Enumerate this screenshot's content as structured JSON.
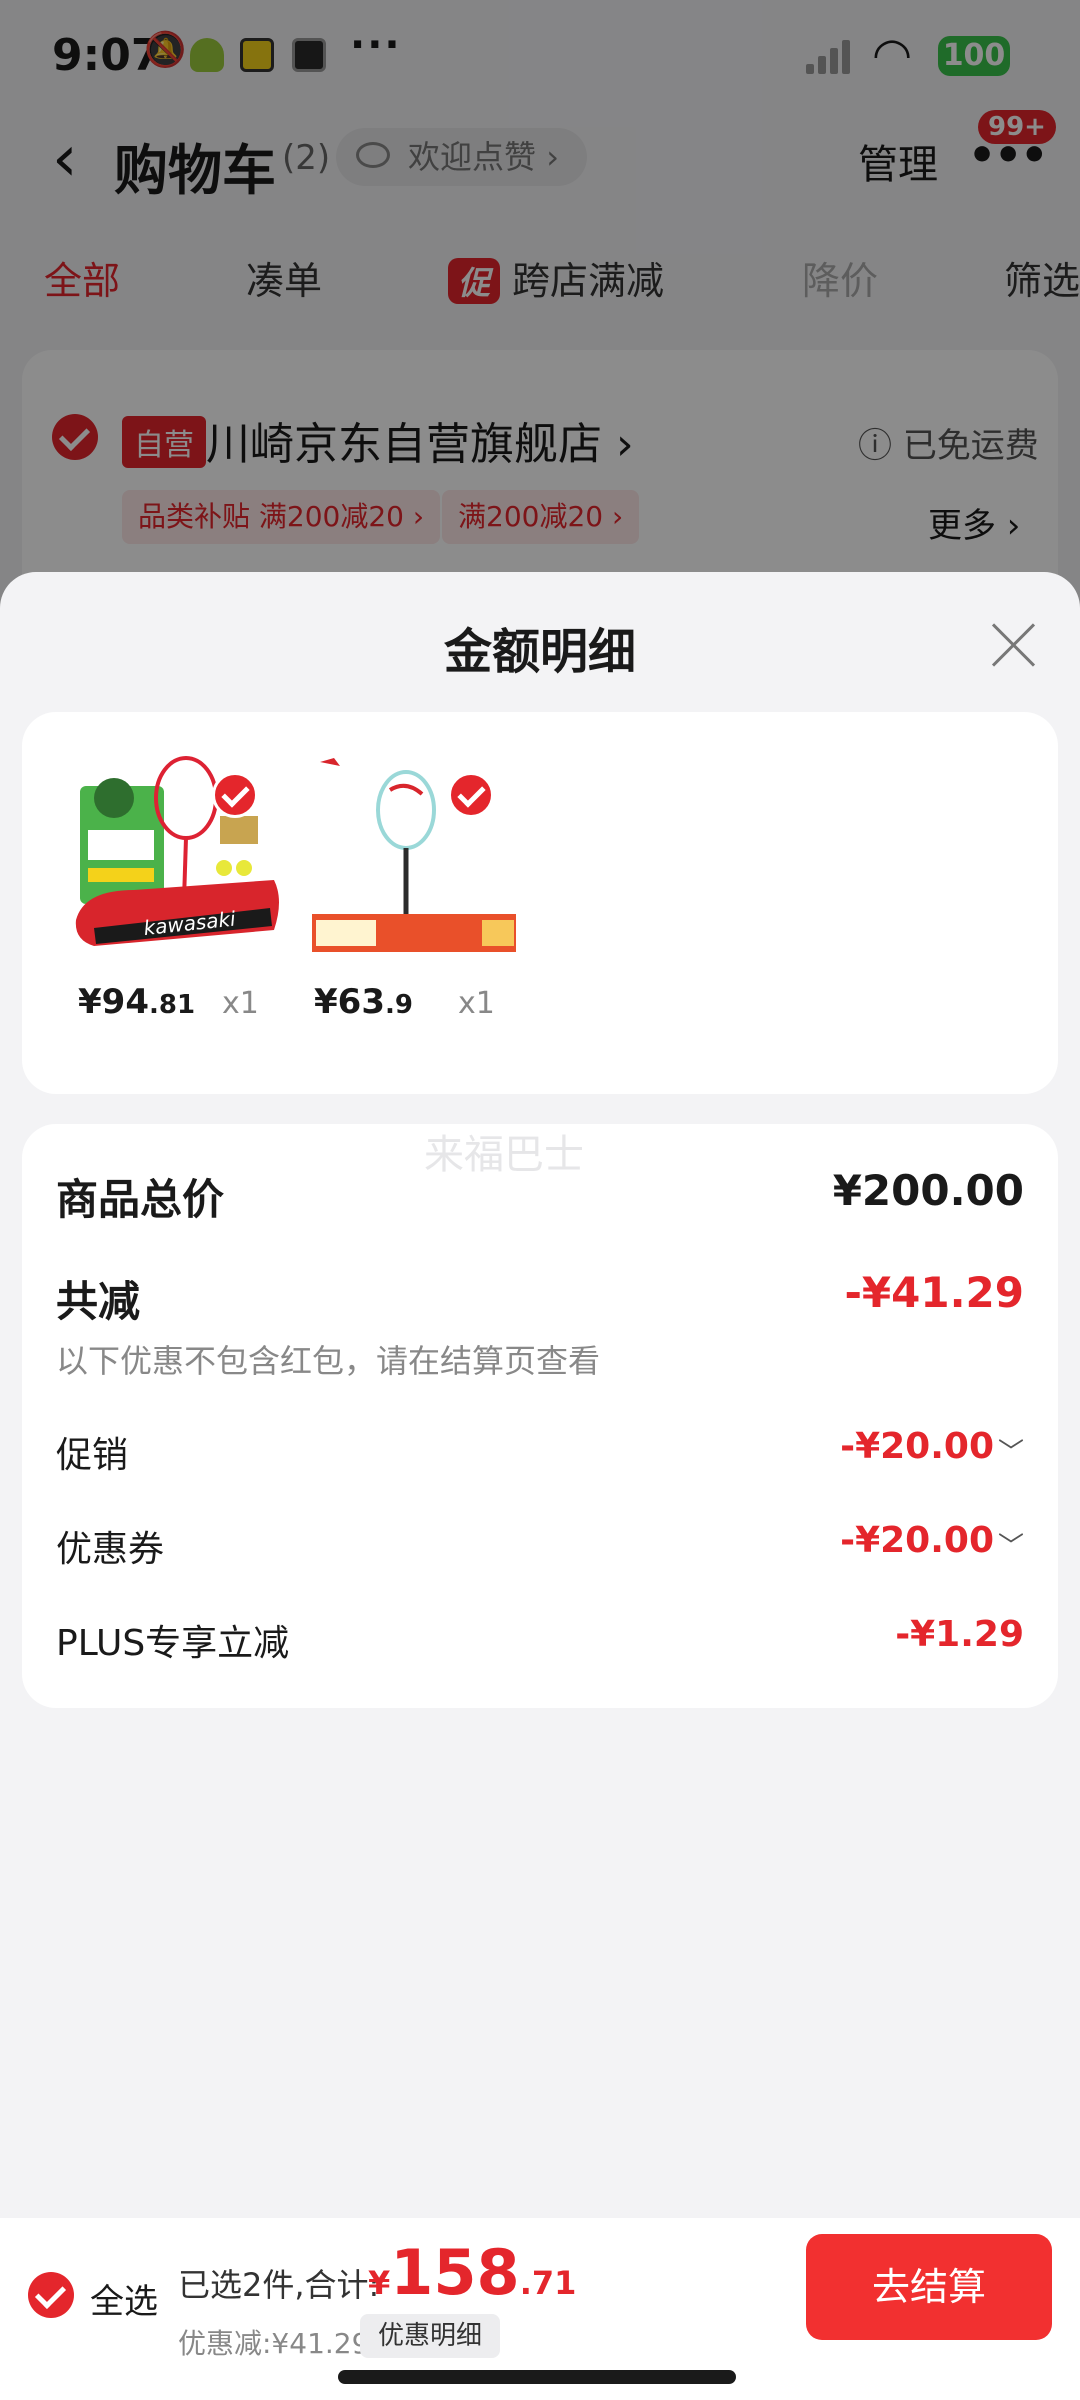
{
  "status_bar": {
    "time": "9:07",
    "battery": "100"
  },
  "nav": {
    "title": "购物车",
    "count": "(2)",
    "welcome": "欢迎点赞",
    "manage": "管理",
    "badge": "99+"
  },
  "tabs": [
    {
      "label": "全部"
    },
    {
      "label": "凑单"
    },
    {
      "label": "跨店满减",
      "badge": "促"
    },
    {
      "label": "降价"
    },
    {
      "label": "筛选"
    }
  ],
  "shop": {
    "tag": "自营",
    "name": "川崎京东自营旗舰店",
    "shipping": "已免运费",
    "promo_tags": [
      "品类补贴 满200减20 ›",
      "满200减20 ›"
    ],
    "more": "更多 ›"
  },
  "sheet": {
    "title": "金额明细",
    "items": [
      {
        "price_main": "¥94",
        "price_decimal": ".81",
        "qty": "x1"
      },
      {
        "price_main": "¥63",
        "price_decimal": ".9",
        "qty": "x1"
      }
    ],
    "watermark": "来福巴士",
    "total_label": "商品总价",
    "total_value": "¥200.00",
    "saved_label": "共减",
    "saved_value": "-¥41.29",
    "note": "以下优惠不包含红包，请在结算页查看",
    "promo_label": "促销",
    "promo_value": "-¥20.00",
    "coupon_label": "优惠券",
    "coupon_value": "-¥20.00",
    "plus_label": "PLUS专享立减",
    "plus_value": "-¥1.29"
  },
  "bottom_bar": {
    "select_all": "全选",
    "selected_text": "已选2件,合计:",
    "currency": "¥",
    "amount_main": "158",
    "amount_decimal": ".71",
    "discount_text": "优惠减:¥41.29",
    "detail_button": "优惠明细",
    "checkout": "去结算"
  },
  "colors": {
    "accent": "#e4262c",
    "checkout": "#f23030"
  }
}
